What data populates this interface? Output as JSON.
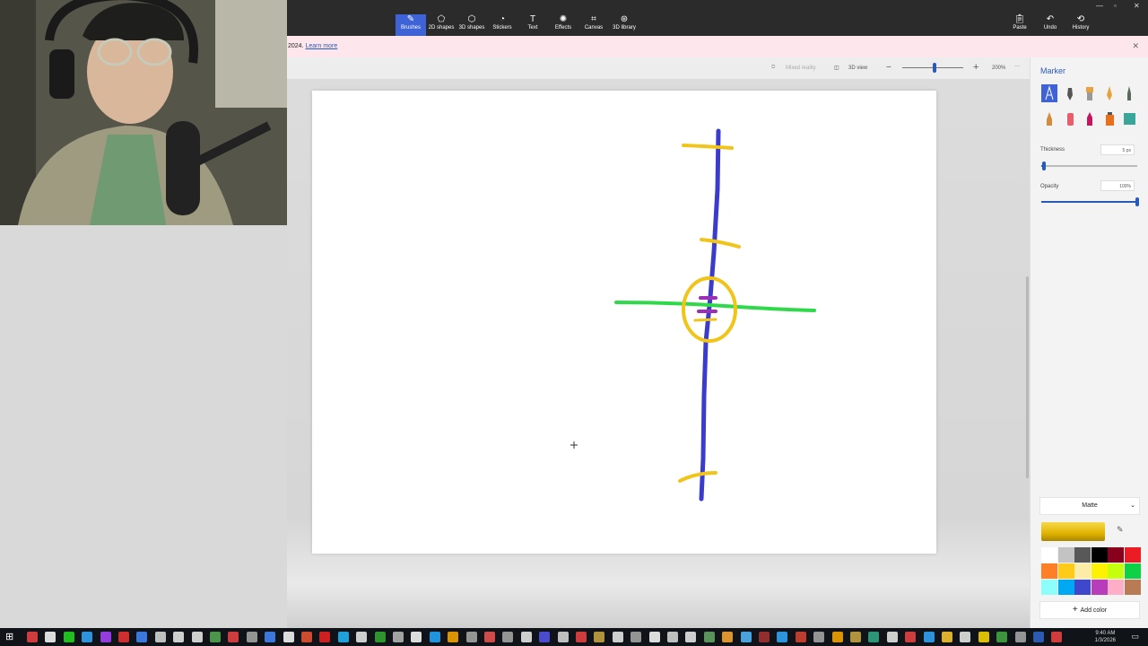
{
  "ribbon": {
    "tools": [
      {
        "label": "Brushes",
        "icon": "brush-icon"
      },
      {
        "label": "2D shapes",
        "icon": "shapes-2d-icon"
      },
      {
        "label": "3D shapes",
        "icon": "shapes-3d-icon"
      },
      {
        "label": "Stickers",
        "icon": "sticker-icon"
      },
      {
        "label": "Text",
        "icon": "text-icon"
      },
      {
        "label": "Effects",
        "icon": "effects-icon"
      },
      {
        "label": "Canvas",
        "icon": "canvas-icon"
      },
      {
        "label": "3D library",
        "icon": "library-3d-icon"
      }
    ],
    "right_tools": [
      {
        "label": "Paste",
        "icon": "paste-icon"
      },
      {
        "label": "Undo",
        "icon": "undo-icon"
      },
      {
        "label": "History",
        "icon": "history-icon"
      }
    ],
    "active_color": "#3d63d6"
  },
  "notice": {
    "text": "2024.",
    "link": "Learn more"
  },
  "viewbar": {
    "mixed_reality": "Mixed reality",
    "view_3d": "3D view",
    "zoom": "200%",
    "more": "···"
  },
  "panel": {
    "title": "Marker",
    "thickness_label": "Thickness",
    "thickness_value": "5 px",
    "thickness_level": 0.03,
    "opacity_label": "Opacity",
    "opacity_value": "100%",
    "opacity_level": 1.0,
    "finish": "Matte",
    "current_color": "#e0b300",
    "add_color": "Add color",
    "palette": [
      "#ffffff",
      "#c3c3c3",
      "#585858",
      "#000000",
      "#88001b",
      "#ec1c24",
      "#ff7f27",
      "#ffca18",
      "#fdeca6",
      "#fff200",
      "#c4ff0e",
      "#0ed145",
      "#8cfffb",
      "#00a8f3",
      "#3f48cc",
      "#b83dba",
      "#ffaec8",
      "#b97a56"
    ]
  },
  "taskbar": {
    "time": "9:40 AM",
    "date": "1/3/2026"
  },
  "drawing": {
    "stroke_colors": [
      "#3b3bcc",
      "#f0c419",
      "#2fd94a",
      "#9b2fb5"
    ]
  }
}
